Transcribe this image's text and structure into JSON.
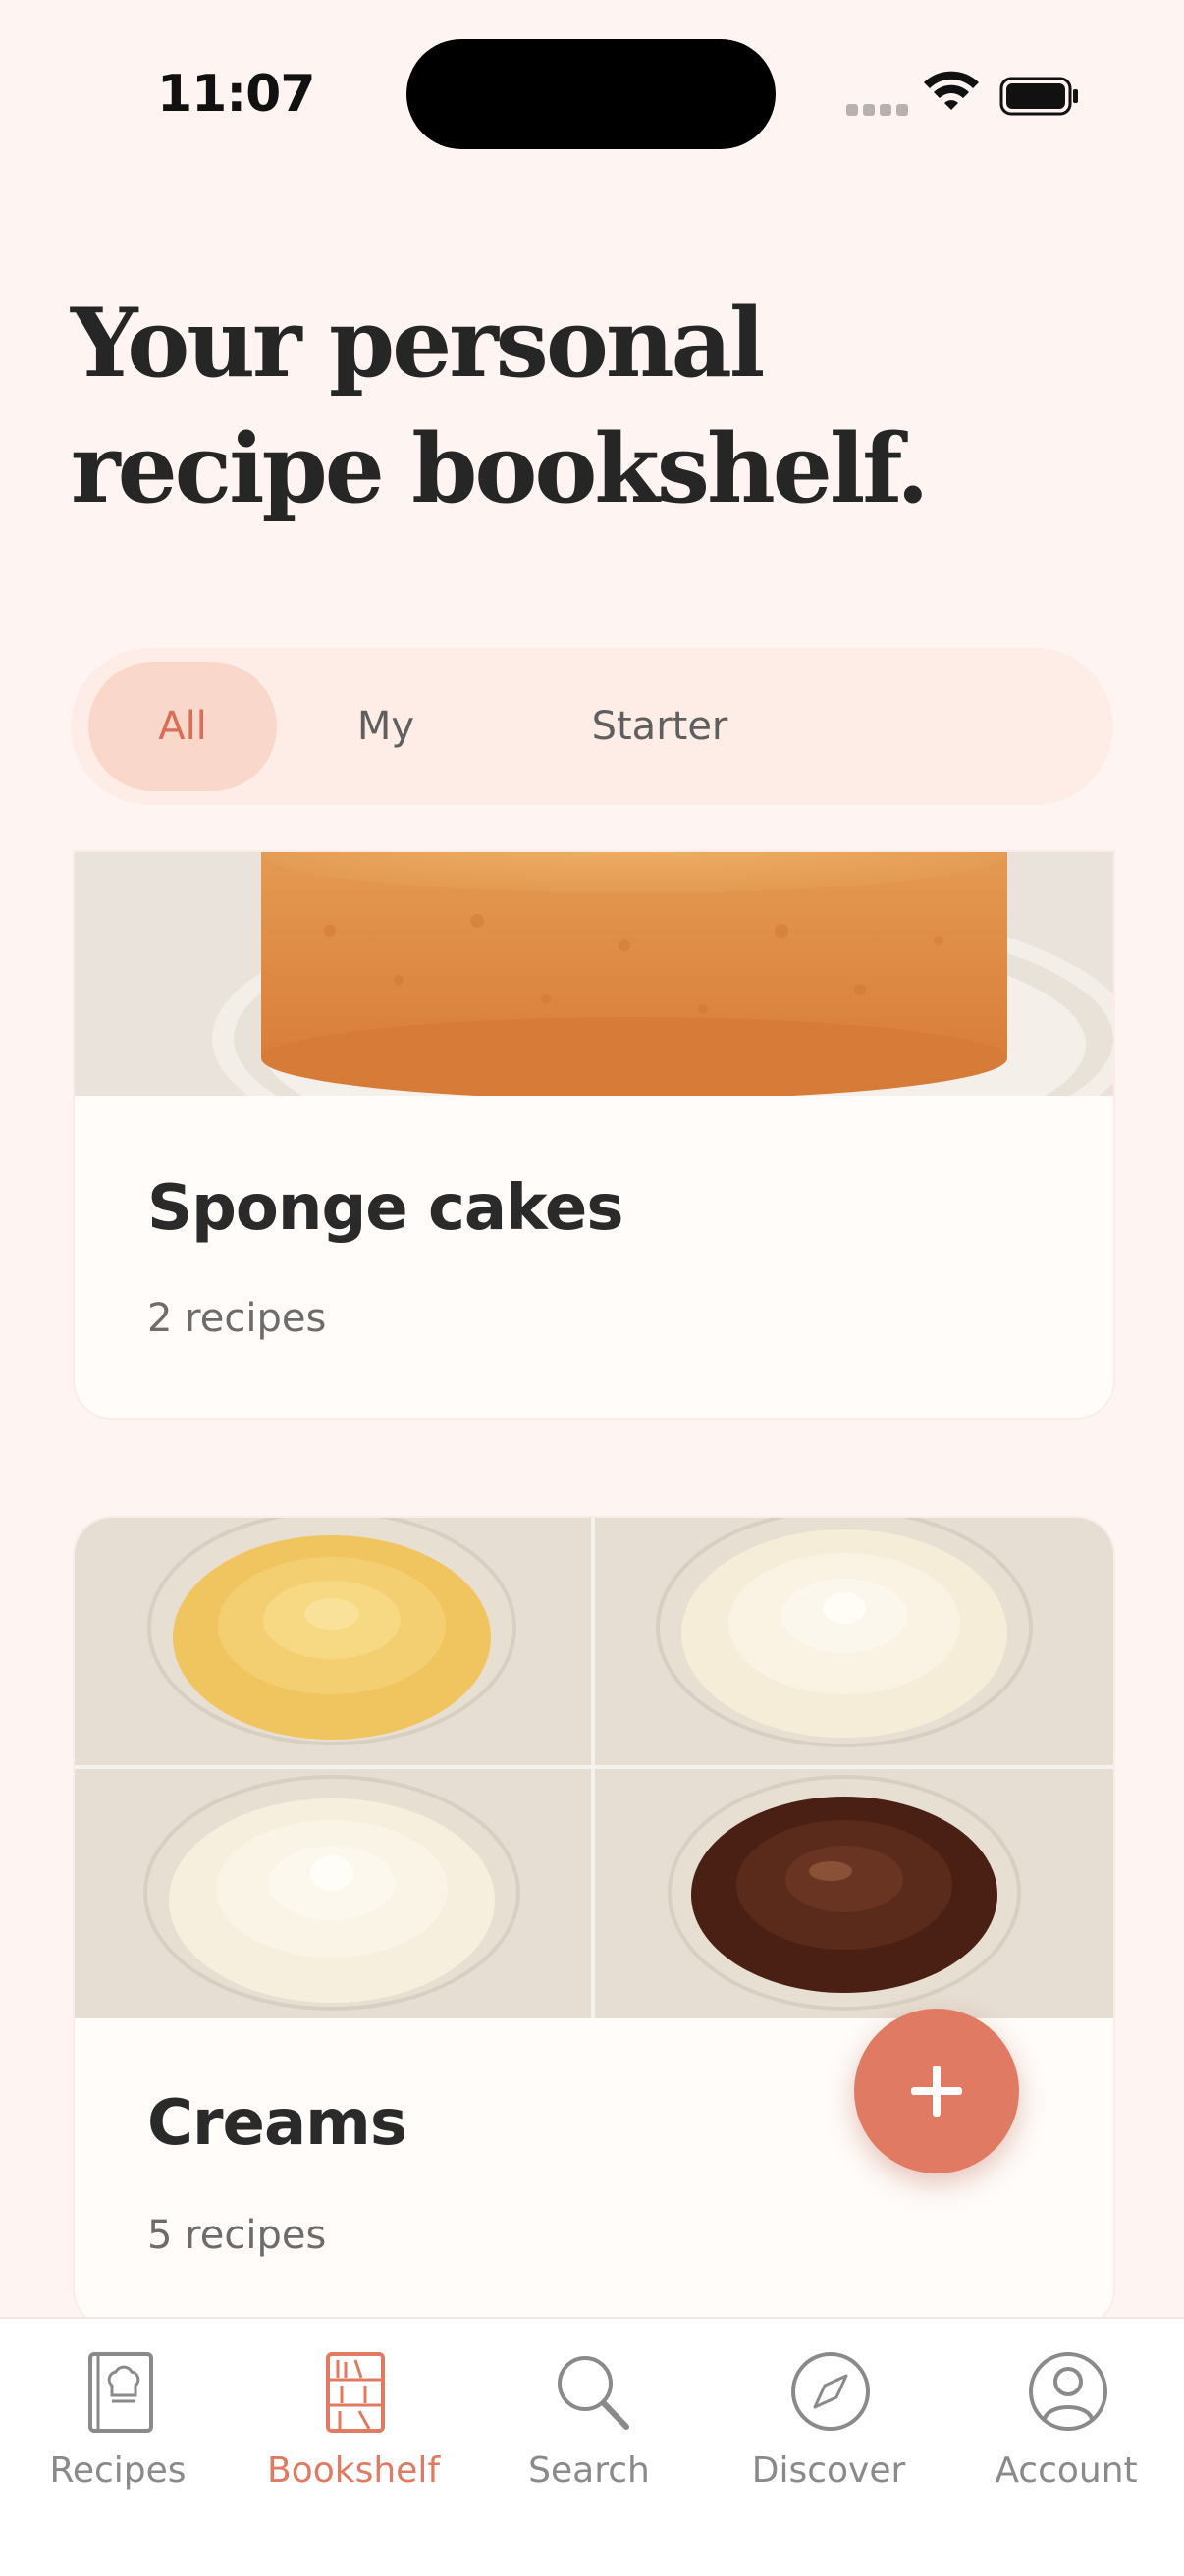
{
  "status": {
    "time": "11:07"
  },
  "header": {
    "title": "Your personal recipe bookshelf."
  },
  "filters": [
    {
      "label": "All",
      "selected": true
    },
    {
      "label": "My",
      "selected": false
    },
    {
      "label": "Starter",
      "selected": false
    }
  ],
  "cards": [
    {
      "title": "Sponge cakes",
      "count": "2 recipes",
      "image": "sponge-cake-photo"
    },
    {
      "title": "Creams",
      "count": "5 recipes",
      "image": "creams-collage-photo"
    }
  ],
  "fab": {
    "icon": "plus-icon"
  },
  "tabbar": {
    "items": [
      {
        "label": "Recipes",
        "icon": "recipe-book-icon",
        "active": false
      },
      {
        "label": "Bookshelf",
        "icon": "bookshelf-icon",
        "active": true
      },
      {
        "label": "Search",
        "icon": "search-icon",
        "active": false
      },
      {
        "label": "Discover",
        "icon": "compass-icon",
        "active": false
      },
      {
        "label": "Account",
        "icon": "person-icon",
        "active": false
      }
    ]
  },
  "colors": {
    "accent": "#E07A62",
    "background": "#FEF5F3",
    "filter_bg": "#FDEDE6",
    "filter_active_bg": "#F9D7CB"
  }
}
